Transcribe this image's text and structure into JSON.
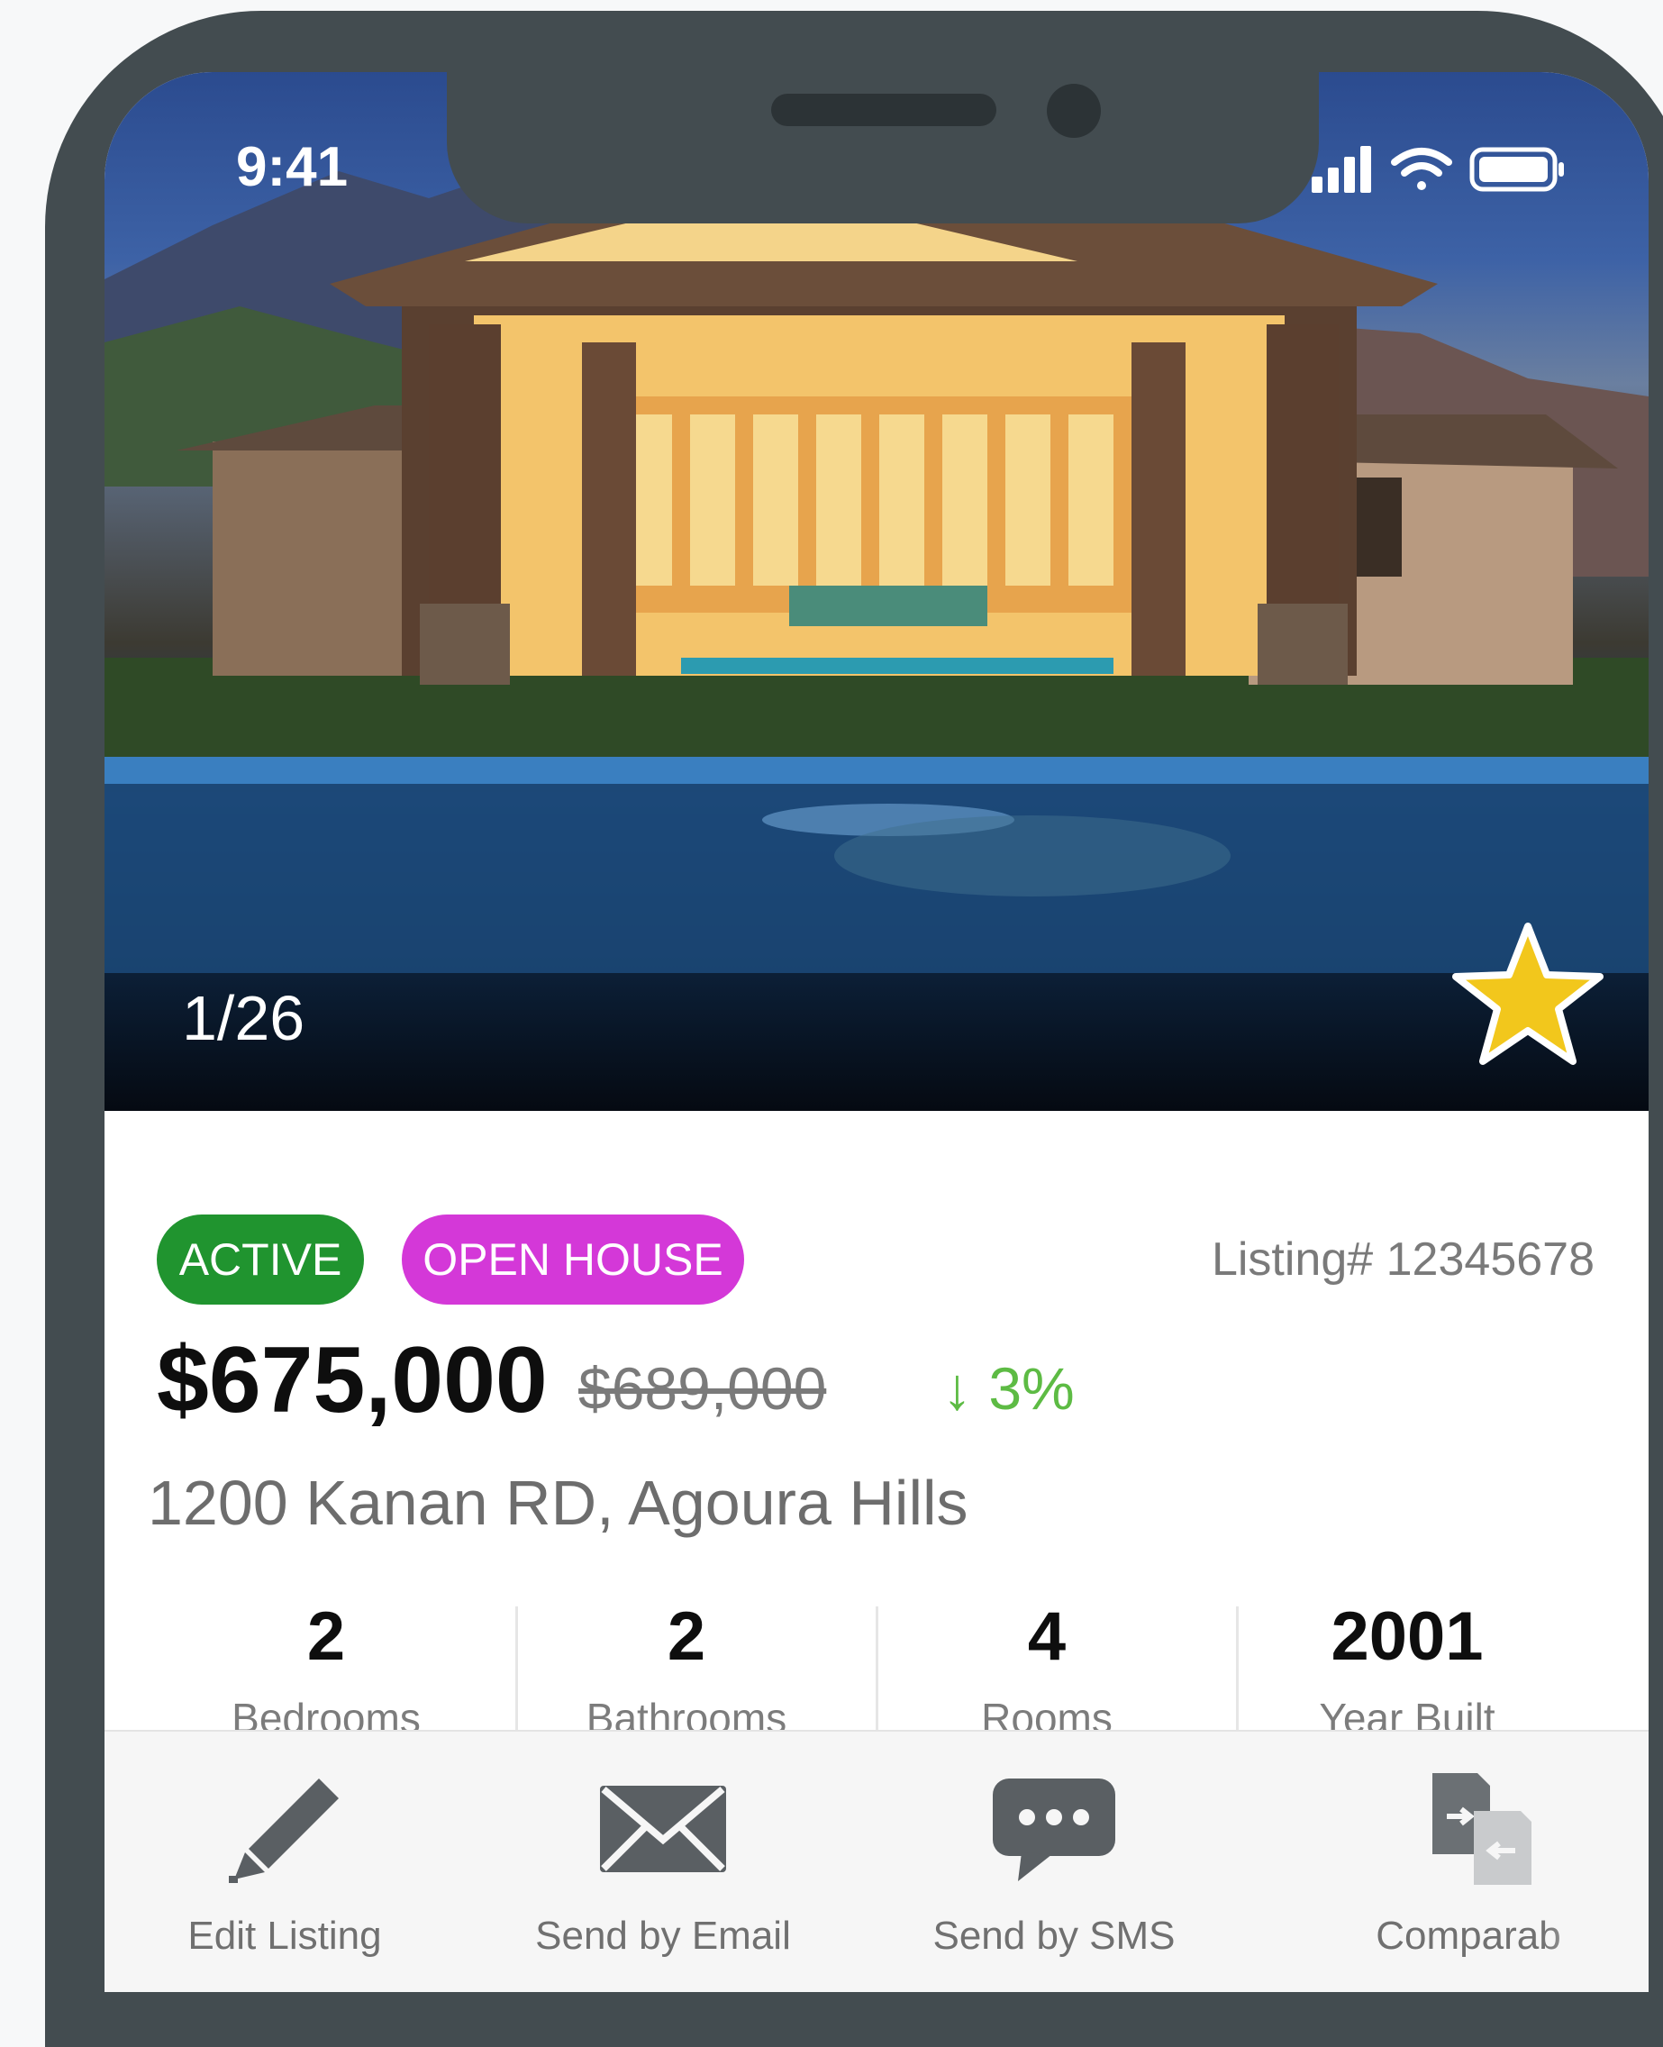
{
  "status_bar": {
    "time": "9:41"
  },
  "gallery": {
    "counter": "1/26"
  },
  "badges": {
    "active": "ACTIVE",
    "open_house": "OPEN HOUSE"
  },
  "listing": {
    "number": "Listing# 12345678",
    "price": "$675,000",
    "old_price": "$689,000",
    "change": "↓ 3%",
    "address": "1200 Kanan RD, Agoura Hills"
  },
  "stats": [
    {
      "value": "2",
      "label": "Bedrooms"
    },
    {
      "value": "2",
      "label": "Bathrooms"
    },
    {
      "value": "4",
      "label": "Rooms"
    },
    {
      "value": "2001",
      "label": "Year Built"
    }
  ],
  "actions": [
    {
      "label": "Edit Listing",
      "icon": "pencil-icon"
    },
    {
      "label": "Send by Email",
      "icon": "envelope-icon"
    },
    {
      "label": "Send by SMS",
      "icon": "chat-bubble-icon"
    },
    {
      "label": "Comparab",
      "icon": "compare-documents-icon"
    }
  ],
  "colors": {
    "frame": "#434c50",
    "active_badge": "#20942f",
    "open_house_badge": "#d438d8",
    "price_drop": "#5dbb44",
    "favorite_star": "#f2c71c"
  }
}
